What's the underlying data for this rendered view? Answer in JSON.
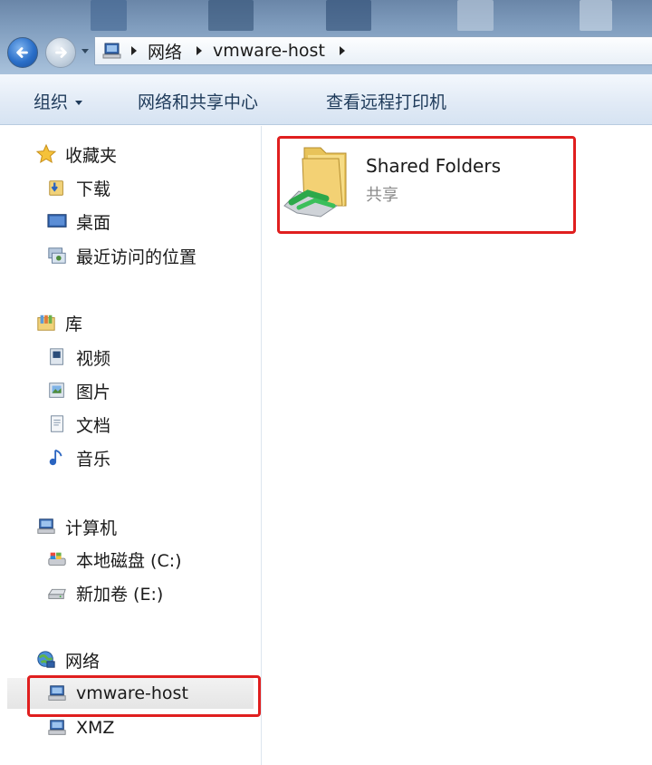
{
  "address_bar": {
    "breadcrumbs": [
      "网络",
      "vmware-host"
    ]
  },
  "toolbar": {
    "organize": "组织",
    "network_center": "网络和共享中心",
    "view_printers": "查看远程打印机"
  },
  "nav": {
    "favorites": {
      "header": "收藏夹",
      "items": [
        "下载",
        "桌面",
        "最近访问的位置"
      ]
    },
    "libraries": {
      "header": "库",
      "items": [
        "视频",
        "图片",
        "文档",
        "音乐"
      ]
    },
    "computer": {
      "header": "计算机",
      "items": [
        "本地磁盘 (C:)",
        "新加卷 (E:)"
      ]
    },
    "network": {
      "header": "网络",
      "items": [
        "vmware-host",
        "XMZ"
      ],
      "selected": "vmware-host"
    }
  },
  "content": {
    "items": [
      {
        "name": "Shared Folders",
        "type": "共享",
        "icon": "shared-folder-icon"
      }
    ]
  },
  "colors": {
    "highlight": "#e01f1f",
    "toolbar_text": "#1e3a5a",
    "subtitle": "#8a8a8a"
  }
}
